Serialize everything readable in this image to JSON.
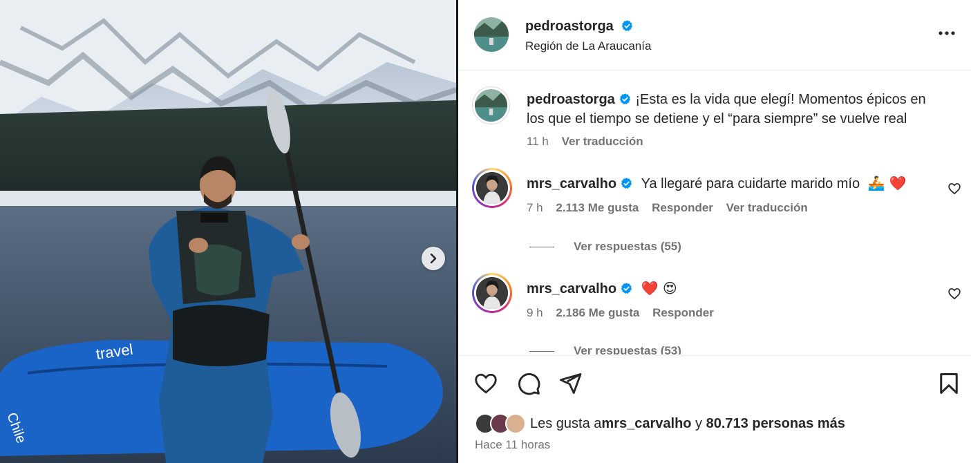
{
  "post": {
    "username": "pedroastorga",
    "location": "Región de La Araucanía"
  },
  "caption": {
    "username": "pedroastorga",
    "text": "¡Esta es la vida que elegí! Momentos épicos en los que el tiempo se detiene y el “para siempre” se vuelve real",
    "time": "11 h",
    "translate": "Ver traducción"
  },
  "comments": [
    {
      "username": "mrs_carvalho",
      "text": "Ya llegaré para cuidarte marido mío",
      "emoji": "🚣 ❤️",
      "time": "7 h",
      "likes": "2.113 Me gusta",
      "reply": "Responder",
      "translate": "Ver traducción",
      "replies": "Ver respuestas (55)"
    },
    {
      "username": "mrs_carvalho",
      "text": "",
      "emoji": "❤️ 😍",
      "time": "9 h",
      "likes": "2.186 Me gusta",
      "reply": "Responder",
      "replies": "Ver respuestas (53)"
    }
  ],
  "likes": {
    "prefix": "Les gusta a ",
    "user": "mrs_carvalho",
    "middle": " y ",
    "count": "80.713 personas más"
  },
  "time_ago": "Hace 11 horas",
  "colors": {
    "verified": "#0095f6",
    "heart": "#ff3040",
    "text": "#262626",
    "muted": "#737373"
  },
  "icons": [
    "verified-icon",
    "more-options-icon",
    "heart-icon",
    "comment-icon",
    "share-icon",
    "bookmark-icon",
    "chevron-right-icon"
  ]
}
